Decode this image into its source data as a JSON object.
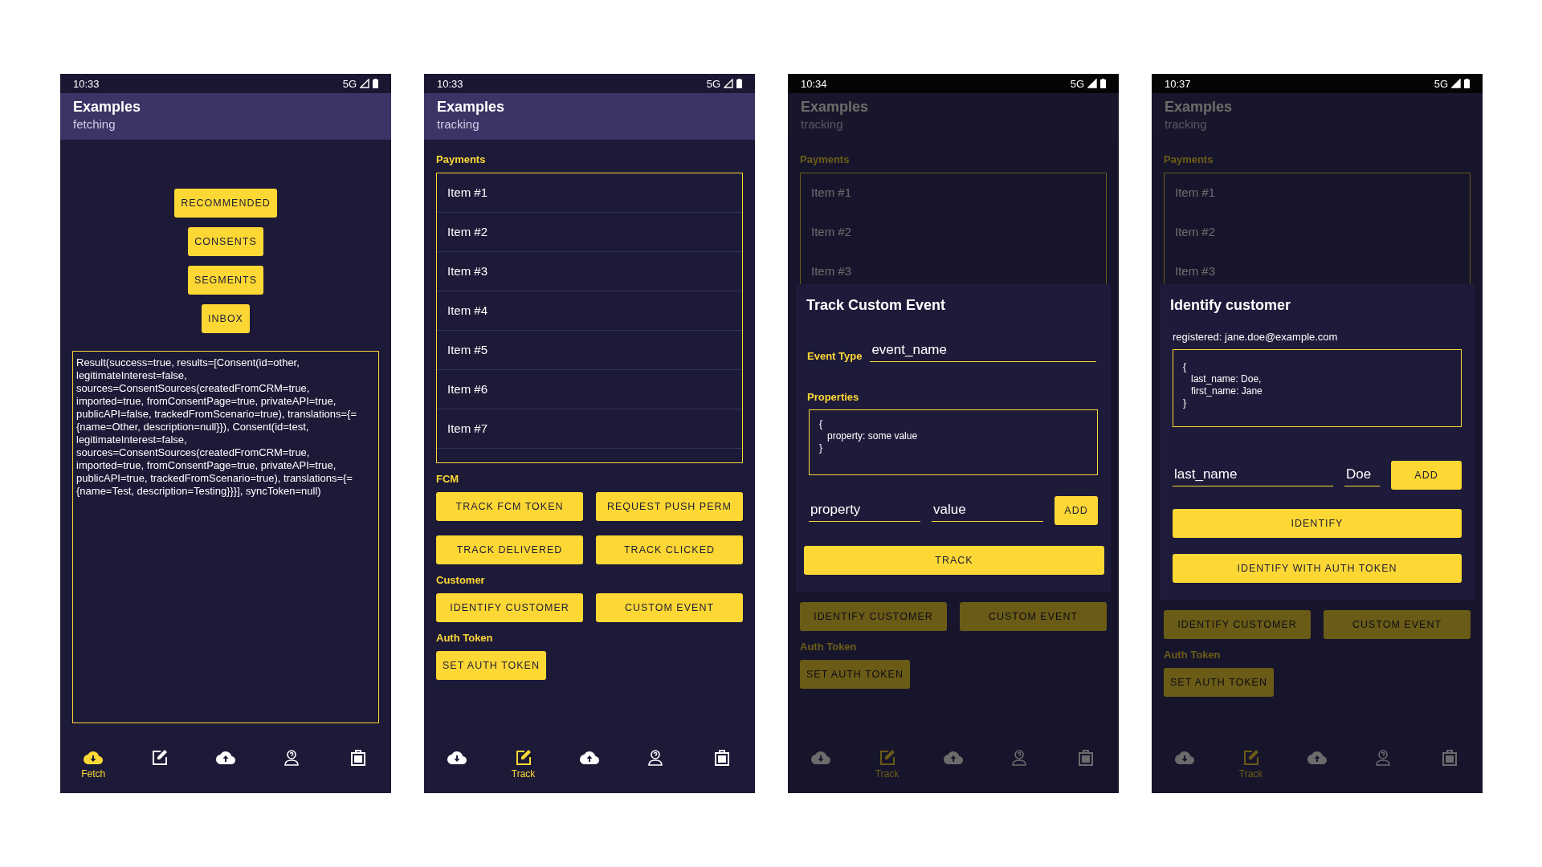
{
  "phones": [
    {
      "status": {
        "time": "10:33",
        "network": "5G"
      },
      "app_bar": {
        "title": "Examples",
        "subtitle": "fetching"
      },
      "screen": {
        "kind": "fetch",
        "buttons": [
          "RECOMMENDED",
          "CONSENTS",
          "SEGMENTS",
          "INBOX"
        ],
        "result": "Result(success=true, results=[Consent(id=other, legitimateInterest=false, sources=ConsentSources(createdFromCRM=true, imported=true, fromConsentPage=true, privateAPI=true, publicAPI=false, trackedFromScenario=true), translations={={name=Other, description=null}}), Consent(id=test, legitimateInterest=false, sources=ConsentSources(createdFromCRM=true, imported=true, fromConsentPage=true, privateAPI=true, publicAPI=true, trackedFromScenario=true), translations={={name=Test, description=Testing}}}], syncToken=null)"
      },
      "nav": [
        {
          "selected": true,
          "label": "Fetch"
        },
        {
          "selected": false
        },
        {
          "selected": false
        },
        {
          "selected": false
        },
        {
          "selected": false
        }
      ]
    },
    {
      "status": {
        "time": "10:33",
        "network": "5G"
      },
      "app_bar": {
        "title": "Examples",
        "subtitle": "tracking"
      },
      "screen": {
        "kind": "track",
        "sections": [
          {
            "kind": "list",
            "label": "Payments",
            "items": [
              "Item #1",
              "Item #2",
              "Item #3",
              "Item #4",
              "Item #5",
              "Item #6",
              "Item #7"
            ]
          },
          {
            "kind": "buttons",
            "label": "FCM",
            "buttons": [
              "TRACK FCM TOKEN",
              "REQUEST PUSH PERM",
              "TRACK DELIVERED",
              "TRACK CLICKED"
            ]
          },
          {
            "kind": "buttons",
            "label": "Customer",
            "buttons": [
              "IDENTIFY CUSTOMER",
              "CUSTOM EVENT"
            ]
          },
          {
            "kind": "buttons",
            "label": "Auth Token",
            "buttons": [
              "SET AUTH TOKEN"
            ]
          }
        ]
      },
      "nav": [
        {
          "selected": false
        },
        {
          "selected": true,
          "label": "Track"
        },
        {
          "selected": false
        },
        {
          "selected": false
        },
        {
          "selected": false
        }
      ]
    },
    {
      "status": {
        "time": "10:34",
        "network": "5G"
      },
      "app_bar": {
        "title": "Examples",
        "subtitle": "tracking"
      },
      "screen": {
        "kind": "track",
        "sections": [
          {
            "kind": "list",
            "label": "Payments",
            "items": [
              "Item #1",
              "Item #2",
              "Item #3"
            ]
          },
          {
            "kind": "buttons",
            "buttons": [
              "IDENTIFY CUSTOMER",
              "CUSTOM EVENT"
            ]
          },
          {
            "kind": "buttons",
            "label": "Auth Token",
            "buttons": [
              "SET AUTH TOKEN"
            ]
          }
        ]
      },
      "dialog": {
        "kind": "event",
        "title": "Track Custom Event",
        "event_type": {
          "label": "Event Type",
          "value": "event_name"
        },
        "properties_label": "Properties",
        "json": "{\n   property: some value\n}",
        "key_value": "property",
        "value_value": "value",
        "add_button": "ADD",
        "actions": [
          "TRACK"
        ]
      },
      "nav": [
        {
          "selected": false
        },
        {
          "selected": true,
          "label": "Track"
        },
        {
          "selected": false
        },
        {
          "selected": false
        },
        {
          "selected": false
        }
      ]
    },
    {
      "status": {
        "time": "10:37",
        "network": "5G"
      },
      "app_bar": {
        "title": "Examples",
        "subtitle": "tracking"
      },
      "screen": {
        "kind": "track",
        "sections": [
          {
            "kind": "list",
            "label": "Payments",
            "items": [
              "Item #1",
              "Item #2",
              "Item #3"
            ]
          },
          {
            "kind": "buttons",
            "buttons": [
              "IDENTIFY CUSTOMER",
              "CUSTOM EVENT"
            ]
          },
          {
            "kind": "buttons",
            "label": "Auth Token",
            "buttons": [
              "SET AUTH TOKEN"
            ]
          }
        ]
      },
      "dialog": {
        "kind": "identify",
        "title": "Identify customer",
        "registered": "registered: jane.doe@example.com",
        "json": "{\n   last_name: Doe,\n   first_name: Jane\n}",
        "key_value": "last_name",
        "value_value": "Doe",
        "add_button": "ADD",
        "actions": [
          "IDENTIFY",
          "IDENTIFY WITH AUTH TOKEN"
        ]
      },
      "nav": [
        {
          "selected": false
        },
        {
          "selected": true,
          "label": "Track"
        },
        {
          "selected": false
        },
        {
          "selected": false
        },
        {
          "selected": false
        }
      ]
    }
  ]
}
